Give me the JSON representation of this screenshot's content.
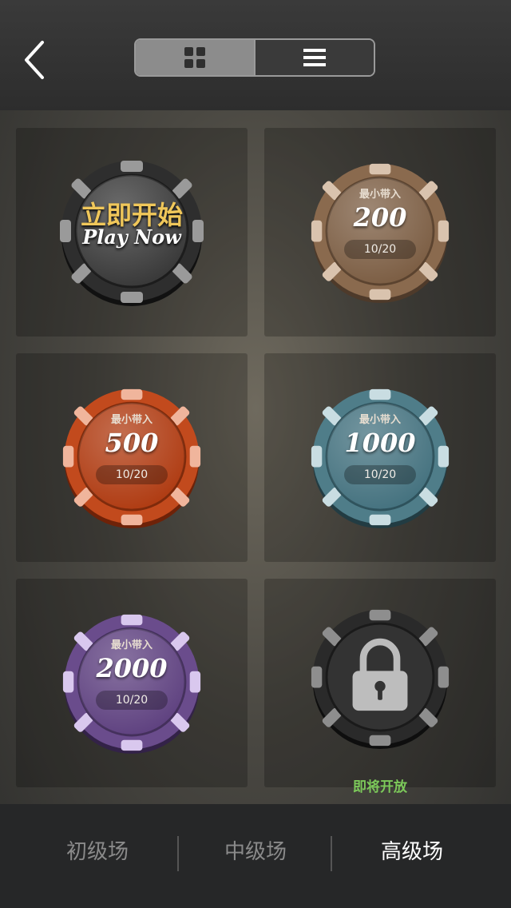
{
  "header": {
    "back_icon": "back-chevron-icon",
    "view_toggle": [
      {
        "id": "grid",
        "icon": "grid-icon",
        "active": true
      },
      {
        "id": "list",
        "icon": "list-icon",
        "active": false
      }
    ]
  },
  "rooms": [
    {
      "type": "play_now",
      "title_cn": "立即开始",
      "title_en": "Play Now",
      "color": "#2e2e2e"
    },
    {
      "type": "room",
      "label": "最小带入",
      "min_buyin": "200",
      "count": "10/20",
      "color": "#8a6a4e"
    },
    {
      "type": "room",
      "label": "最小带入",
      "min_buyin": "500",
      "count": "10/20",
      "color": "#c24a1d"
    },
    {
      "type": "room",
      "label": "最小带入",
      "min_buyin": "1000",
      "count": "10/20",
      "color": "#4f7d89"
    },
    {
      "type": "room",
      "label": "最小带入",
      "min_buyin": "2000",
      "count": "10/20",
      "color": "#6a4c8c"
    },
    {
      "type": "locked",
      "status": "即将开放",
      "icon": "lock-icon",
      "color": "#2a2a2a"
    }
  ],
  "tabs": [
    {
      "label": "初级场",
      "active": false
    },
    {
      "label": "中级场",
      "active": false
    },
    {
      "label": "高级场",
      "active": true
    }
  ]
}
